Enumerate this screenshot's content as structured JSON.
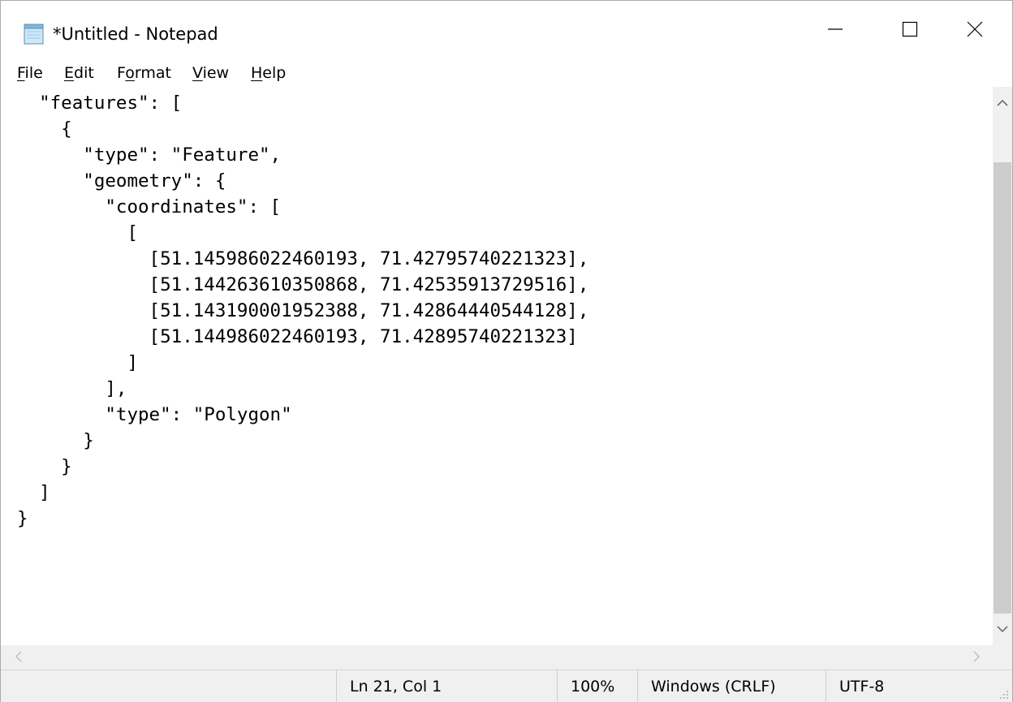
{
  "window": {
    "title": "*Untitled - Notepad",
    "icons": {
      "app": "notepad-icon",
      "minimize": "minimize-icon",
      "maximize": "maximize-icon",
      "close": "close-icon"
    }
  },
  "menu": {
    "file": {
      "mnemonic": "F",
      "rest": "ile"
    },
    "edit": {
      "mnemonic": "E",
      "rest": "dit"
    },
    "format": {
      "pre": "F",
      "mnemonic": "o",
      "rest": "rmat"
    },
    "view": {
      "mnemonic": "V",
      "rest": "iew"
    },
    "help": {
      "mnemonic": "H",
      "rest": "elp"
    }
  },
  "editor": {
    "lines": [
      "  \"features\": [",
      "    {",
      "      \"type\": \"Feature\",",
      "      \"geometry\": {",
      "        \"coordinates\": [",
      "          [",
      "            [51.145986022460193, 71.42795740221323],",
      "            [51.144263610350868, 71.42535913729516],",
      "            [51.143190001952388, 71.42864440544128],",
      "            [51.144986022460193, 71.42895740221323]",
      "          ]",
      "        ],",
      "        \"type\": \"Polygon\"",
      "      }",
      "    }",
      "  ]",
      "}"
    ]
  },
  "status": {
    "position": "Ln 21, Col 1",
    "zoom": "100%",
    "line_ending": "Windows (CRLF)",
    "encoding": "UTF-8"
  }
}
